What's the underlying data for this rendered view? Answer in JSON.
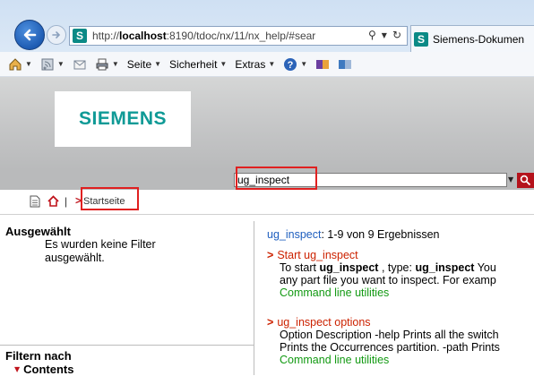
{
  "browser": {
    "url_prefix": "http://",
    "url_host": "localhost",
    "url_rest": ":8190/tdoc/nx/11/nx_help/#sear",
    "tab_title": "Siemens-Dokumen",
    "favicon_letter": "S",
    "commands": {
      "seite": "Seite",
      "sicherheit": "Sicherheit",
      "extras": "Extras"
    }
  },
  "site": {
    "logo_text": "SIEMENS",
    "search_value": "ug_inspect",
    "breadcrumb_current": "Startseite",
    "breadcrumb_separator": "|",
    "breadcrumb_arrow": ">"
  },
  "left_pane": {
    "selected_heading": "Ausgewählt",
    "selected_text": "Es wurden keine Filter ausgewählt.",
    "filter_heading": "Filtern nach",
    "contents_label": "Contents"
  },
  "results": {
    "query": "ug_inspect",
    "summary": ": 1-9 von 9 Ergebnissen",
    "items": [
      {
        "title": "Start ug_inspect",
        "desc_pre": "To start ",
        "desc_b1": "ug_inspect",
        "desc_mid": " , type: ",
        "desc_b2": "ug_inspect",
        "desc_post": " You",
        "desc2": "any part file you want to inspect. For examp",
        "link": "Command line utilities"
      },
      {
        "title": "ug_inspect options",
        "desc": "Option Description -help Prints all the switch",
        "desc2": "Prints the Occurrences partition. -path Prints",
        "link": "Command line utilities"
      }
    ]
  },
  "colors": {
    "siemens_teal": "#0f9a96",
    "highlight_red": "#e02020",
    "result_title": "#cc2200",
    "result_link": "#139a13",
    "query_blue": "#1f5fbf"
  }
}
